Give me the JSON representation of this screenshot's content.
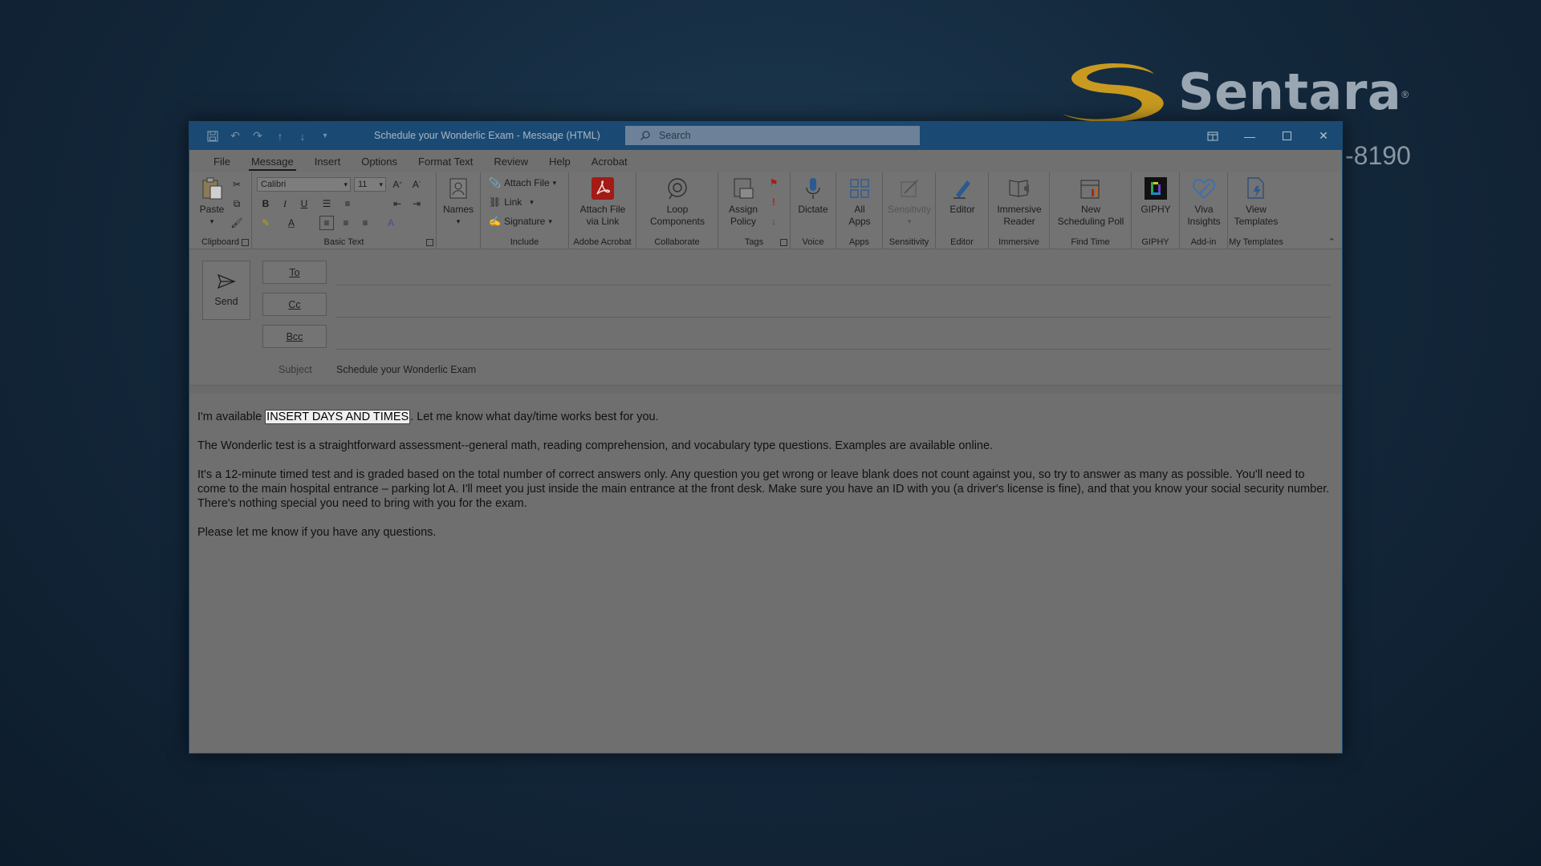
{
  "desktop": {
    "brand_name": "Sentara",
    "brand_reg": "®",
    "phone_fragment": "-8190"
  },
  "window": {
    "title": "Schedule your Wonderlic Exam  -  Message (HTML)",
    "search_placeholder": "Search"
  },
  "menu": {
    "tabs": [
      "File",
      "Message",
      "Insert",
      "Options",
      "Format Text",
      "Review",
      "Help",
      "Acrobat"
    ],
    "active": "Message"
  },
  "ribbon": {
    "clipboard": {
      "label": "Clipboard",
      "paste": "Paste"
    },
    "basic_text": {
      "label": "Basic Text",
      "font": "Calibri",
      "size": "11"
    },
    "names": {
      "label": "Names"
    },
    "include": {
      "label": "Include",
      "attach_file": "Attach File",
      "link": "Link",
      "signature": "Signature"
    },
    "adobe": {
      "label": "Adobe Acrobat",
      "button_line1": "Attach File",
      "button_line2": "via Link"
    },
    "collaborate": {
      "label": "Collaborate",
      "button_line1": "Loop",
      "button_line2": "Components"
    },
    "tags": {
      "label": "Tags",
      "button_line1": "Assign",
      "button_line2": "Policy"
    },
    "voice": {
      "label": "Voice",
      "button": "Dictate"
    },
    "apps": {
      "label": "Apps",
      "button_line1": "All",
      "button_line2": "Apps"
    },
    "sensitivity": {
      "label": "Sensitivity",
      "button": "Sensitivity"
    },
    "editor": {
      "label": "Editor",
      "button": "Editor"
    },
    "immersive": {
      "label": "Immersive",
      "button_line1": "Immersive",
      "button_line2": "Reader"
    },
    "find_time": {
      "label": "Find Time",
      "button_line1": "New",
      "button_line2": "Scheduling Poll"
    },
    "giphy": {
      "label": "GIPHY",
      "button": "GIPHY"
    },
    "addin": {
      "label": "Add-in",
      "button_line1": "Viva",
      "button_line2": "Insights"
    },
    "templates": {
      "label": "My Templates",
      "button_line1": "View",
      "button_line2": "Templates"
    }
  },
  "compose": {
    "send": "Send",
    "to": "To",
    "cc": "Cc",
    "bcc": "Bcc",
    "subject_label": "Subject",
    "subject_value": "Schedule your Wonderlic Exam"
  },
  "body": {
    "p1_before": "I'm available ",
    "p1_highlight": "INSERT DAYS AND TIMES",
    "p1_after": ". Let me know what day/time works best for you.",
    "p2": "The Wonderlic test is a straightforward assessment--general math, reading comprehension, and vocabulary type questions. Examples are available online.",
    "p3": "It's a 12-minute timed test and is graded based on the total number of correct answers only. Any question you get wrong or leave blank does not count against you, so try to answer as many as possible. You'll need to come to the main hospital entrance – parking lot A. I'll meet you just inside the main entrance at the front desk. Make sure you have an ID with you (a driver's license is fine), and that you know your social security number. There's nothing special you need to bring with you for the exam.",
    "p4": "Please let me know if you have any questions."
  }
}
